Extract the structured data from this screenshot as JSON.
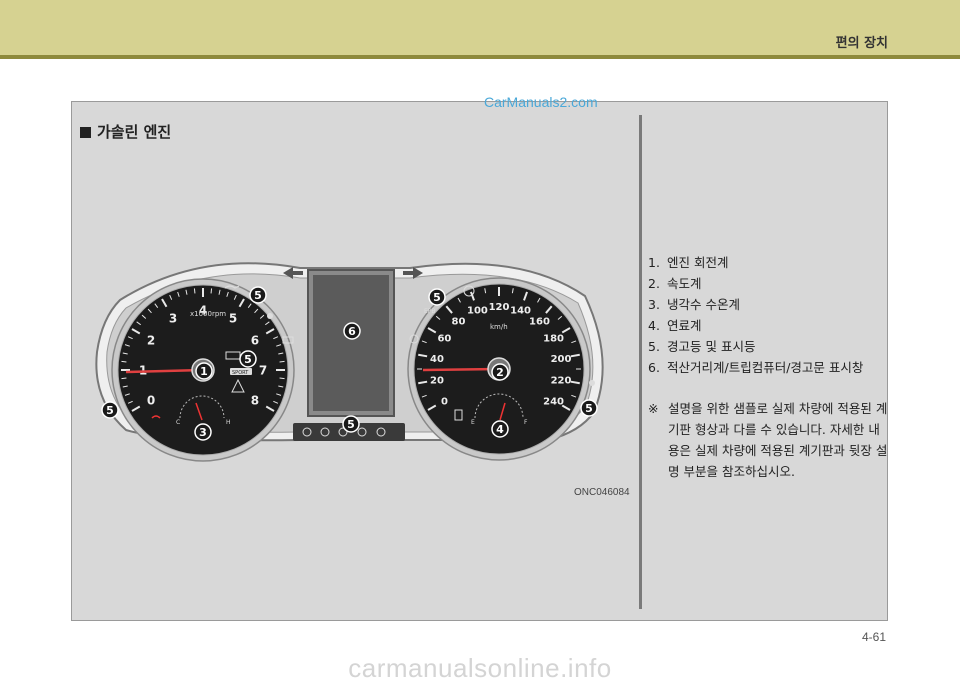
{
  "header": {
    "title": "편의 장치"
  },
  "watermark_top": "CarManuals2.com",
  "section": {
    "title": "가솔린 엔진"
  },
  "tachometer": {
    "scale_label": "x1000rpm",
    "numbers": [
      "0",
      "1",
      "2",
      "3",
      "4",
      "5",
      "6",
      "7",
      "8"
    ],
    "temp_labels": {
      "cold": "C",
      "hot": "H"
    },
    "sport_label": "SPORT"
  },
  "speedometer": {
    "unit": "km/h",
    "numbers": [
      "0",
      "20",
      "40",
      "60",
      "80",
      "100",
      "120",
      "140",
      "160",
      "180",
      "200",
      "220",
      "240"
    ],
    "fuel_labels": {
      "empty": "E",
      "full": "F"
    },
    "epb_label": "EPB"
  },
  "callouts": [
    "1",
    "2",
    "3",
    "4",
    "5",
    "6"
  ],
  "legend": [
    {
      "num": "1.",
      "label": "엔진 회전계"
    },
    {
      "num": "2.",
      "label": "속도계"
    },
    {
      "num": "3.",
      "label": "냉각수 수온계"
    },
    {
      "num": "4.",
      "label": "연료계"
    },
    {
      "num": "5.",
      "label": "경고등 및 표시등"
    },
    {
      "num": "6.",
      "label": "적산거리계/트립컴퓨터/경고문 표시창"
    }
  ],
  "note": {
    "mark": "※",
    "text": "설명을 위한 샘플로 실제 차량에 적용된 계기판 형상과 다를 수 있습니다. 자세한 내용은 실제 차량에 적용된 계기판과 뒷장 설명 부분을 참조하십시오."
  },
  "figure_code": "ONC046084",
  "page_number": "4-61",
  "watermark_bottom": "carmanualsonline.info",
  "colors": {
    "topbar": "#d6d291",
    "topbar_line": "#8e8a3c",
    "frame": "#d8d8d8",
    "gauge_face": "#1c1c1c",
    "callout": "#1a1a1a"
  }
}
